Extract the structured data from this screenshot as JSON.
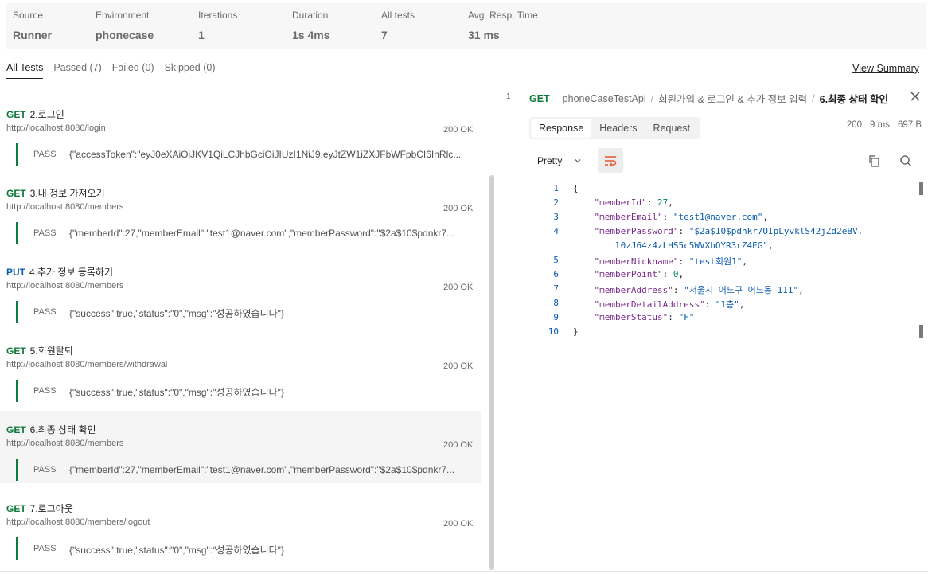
{
  "summary": {
    "source_label": "Source",
    "source_value": "Runner",
    "environment_label": "Environment",
    "environment_value": "phonecase",
    "iterations_label": "Iterations",
    "iterations_value": "1",
    "duration_label": "Duration",
    "duration_value": "1s 4ms",
    "all_tests_label": "All tests",
    "all_tests_value": "7",
    "avg_label": "Avg. Resp. Time",
    "avg_value": "31 ms"
  },
  "tabs": {
    "all": "All Tests",
    "passed": "Passed (7)",
    "failed": "Failed (0)",
    "skipped": "Skipped (0)",
    "view_summary": "View Summary"
  },
  "requests": [
    {
      "method": "GET",
      "name": "2.로그인",
      "url": "http://localhost:8080/login",
      "status": "200 OK",
      "result": "PASS",
      "body": "{\"accessToken\":\"eyJ0eXAiOiJKV1QiLCJhbGciOiJIUzI1NiJ9.eyJtZW1iZXJFbWFpbCI6InRlc..."
    },
    {
      "method": "GET",
      "name": "3.내 정보 가져오기",
      "url": "http://localhost:8080/members",
      "status": "200 OK",
      "result": "PASS",
      "body": "{\"memberId\":27,\"memberEmail\":\"test1@naver.com\",\"memberPassword\":\"$2a$10$pdnkr7..."
    },
    {
      "method": "PUT",
      "name": "4.추가 정보 등록하기",
      "url": "http://localhost:8080/members",
      "status": "200 OK",
      "result": "PASS",
      "body": "{\"success\":true,\"status\":\"0\",\"msg\":\"성공하였습니다\"}"
    },
    {
      "method": "GET",
      "name": "5.회원탈퇴",
      "url": "http://localhost:8080/members/withdrawal",
      "status": "200 OK",
      "result": "PASS",
      "body": "{\"success\":true,\"status\":\"0\",\"msg\":\"성공하였습니다\"}"
    },
    {
      "method": "GET",
      "name": "6.최종 상태 확인",
      "url": "http://localhost:8080/members",
      "status": "200 OK",
      "result": "PASS",
      "body": "{\"memberId\":27,\"memberEmail\":\"test1@naver.com\",\"memberPassword\":\"$2a$10$pdnkr7..."
    },
    {
      "method": "GET",
      "name": "7.로그아웃",
      "url": "http://localhost:8080/members/logout",
      "status": "200 OK",
      "result": "PASS",
      "body": "{\"success\":true,\"status\":\"0\",\"msg\":\"성공하였습니다\"}"
    }
  ],
  "detail": {
    "iteration": "1",
    "method": "GET",
    "collection": "phoneCaseTestApi",
    "folder": "회원가입 & 로그인 & 추가 정보 입력",
    "request": "6.최종 상태 확인",
    "tab_response": "Response",
    "tab_headers": "Headers",
    "tab_request": "Request",
    "status": "200",
    "time": "9 ms",
    "size": "697 B",
    "format": "Pretty"
  },
  "code_lines": [
    {
      "n": "1",
      "parts": [
        [
          "p",
          "{"
        ]
      ]
    },
    {
      "n": "2",
      "parts": [
        [
          "p",
          "    "
        ],
        [
          "k",
          "\"memberId\""
        ],
        [
          "p",
          ": "
        ],
        [
          "n",
          "27"
        ],
        [
          "p",
          ","
        ]
      ]
    },
    {
      "n": "3",
      "parts": [
        [
          "p",
          "    "
        ],
        [
          "k",
          "\"memberEmail\""
        ],
        [
          "p",
          ": "
        ],
        [
          "s",
          "\"test1@naver.com\""
        ],
        [
          "p",
          ","
        ]
      ]
    },
    {
      "n": "4",
      "parts": [
        [
          "p",
          "    "
        ],
        [
          "k",
          "\"memberPassword\""
        ],
        [
          "p",
          ": "
        ],
        [
          "s",
          "\"$2a$10$pdnkr7OIpLyvklS42jZd2eBV."
        ]
      ]
    },
    {
      "n": "",
      "parts": [
        [
          "p",
          "        "
        ],
        [
          "s",
          "l0zJ64z4zLHS5c5WVXhOYR3rZ4EG\""
        ],
        [
          "p",
          ","
        ]
      ]
    },
    {
      "n": "5",
      "parts": [
        [
          "p",
          "    "
        ],
        [
          "k",
          "\"memberNickname\""
        ],
        [
          "p",
          ": "
        ],
        [
          "s",
          "\"test회원1\""
        ],
        [
          "p",
          ","
        ]
      ]
    },
    {
      "n": "6",
      "parts": [
        [
          "p",
          "    "
        ],
        [
          "k",
          "\"memberPoint\""
        ],
        [
          "p",
          ": "
        ],
        [
          "n",
          "0"
        ],
        [
          "p",
          ","
        ]
      ]
    },
    {
      "n": "7",
      "parts": [
        [
          "p",
          "    "
        ],
        [
          "k",
          "\"memberAddress\""
        ],
        [
          "p",
          ": "
        ],
        [
          "s",
          "\"서울시 어느구 어느동 111\""
        ],
        [
          "p",
          ","
        ]
      ]
    },
    {
      "n": "8",
      "parts": [
        [
          "p",
          "    "
        ],
        [
          "k",
          "\"memberDetailAddress\""
        ],
        [
          "p",
          ": "
        ],
        [
          "s",
          "\"1층\""
        ],
        [
          "p",
          ","
        ]
      ]
    },
    {
      "n": "9",
      "parts": [
        [
          "p",
          "    "
        ],
        [
          "k",
          "\"memberStatus\""
        ],
        [
          "p",
          ": "
        ],
        [
          "s",
          "\"F\""
        ]
      ]
    },
    {
      "n": "10",
      "parts": [
        [
          "p",
          "}"
        ]
      ]
    }
  ]
}
